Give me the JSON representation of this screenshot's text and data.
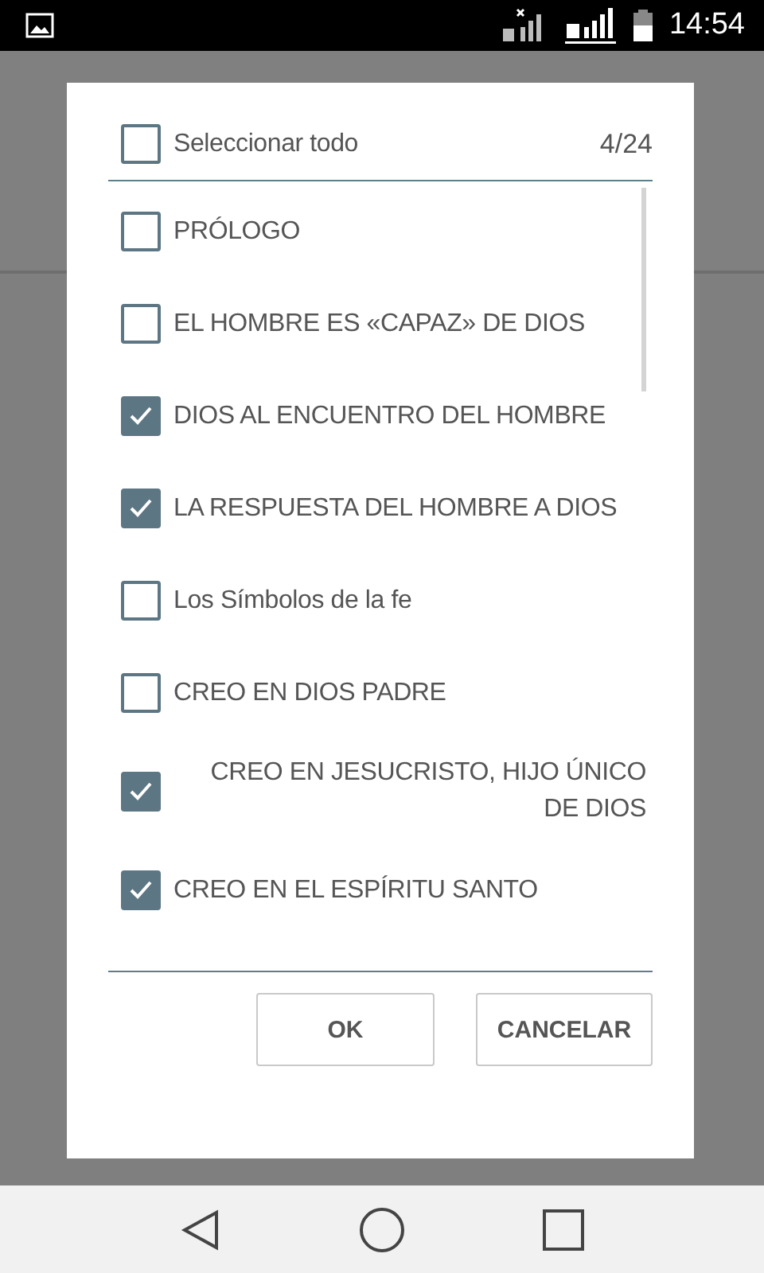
{
  "status_bar": {
    "time": "14:54"
  },
  "dialog": {
    "select_all": {
      "label": "Seleccionar todo",
      "checked": false,
      "count": "4/24"
    },
    "items": [
      {
        "label": "PRÓLOGO",
        "checked": false
      },
      {
        "label": "EL HOMBRE ES «CAPAZ» DE DIOS",
        "checked": false
      },
      {
        "label": "DIOS AL ENCUENTRO DEL HOMBRE",
        "checked": true
      },
      {
        "label": "LA RESPUESTA DEL HOMBRE A DIOS",
        "checked": true
      },
      {
        "label": "Los Símbolos de la fe",
        "checked": false
      },
      {
        "label": "CREO EN DIOS PADRE",
        "checked": false
      },
      {
        "label": "CREO EN JESUCRISTO, HIJO ÚNICO DE DIOS",
        "checked": true
      },
      {
        "label": "CREO EN EL ESPÍRITU SANTO",
        "checked": true
      }
    ],
    "buttons": [
      "OK",
      "CANCELAR"
    ]
  }
}
